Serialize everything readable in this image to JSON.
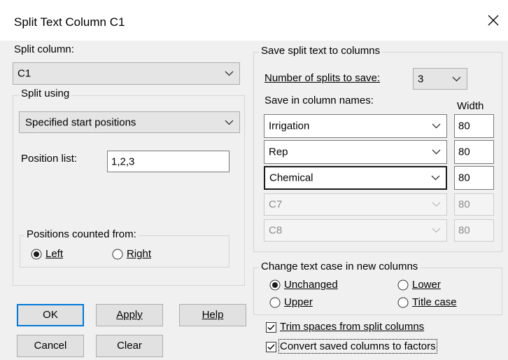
{
  "window": {
    "title": "Split Text Column C1"
  },
  "split_column": {
    "label": "Split column:",
    "value": "C1"
  },
  "split_using": {
    "legend": "Split using",
    "method": "Specified start positions",
    "position_list_label": "Position list:",
    "position_list_value": "1,2,3",
    "positions_from_legend": "Positions counted from:",
    "left_label": "Left",
    "right_label": "Right",
    "selected": "Left"
  },
  "save_split": {
    "legend": "Save split text to columns",
    "num_splits_label": "Number of splits to save:",
    "num_splits_value": "3",
    "names_label": "Save in column names:",
    "width_label": "Width",
    "rows": [
      {
        "name": "Irrigation",
        "width": "80",
        "enabled": true
      },
      {
        "name": "Rep",
        "width": "80",
        "enabled": true
      },
      {
        "name": "Chemical",
        "width": "80",
        "enabled": true
      },
      {
        "name": "C7",
        "width": "80",
        "enabled": false
      },
      {
        "name": "C8",
        "width": "80",
        "enabled": false
      }
    ]
  },
  "text_case": {
    "legend": "Change text case in new columns",
    "unchanged": "Unchanged",
    "lower": "Lower",
    "upper": "Upper",
    "title_case": "Title case",
    "selected": "Unchanged"
  },
  "options": {
    "trim_label": "Trim spaces from split columns",
    "trim_checked": true,
    "factors_label": "Convert saved columns to factors",
    "factors_checked": true
  },
  "buttons": {
    "ok": "OK",
    "apply": "Apply",
    "help": "Help",
    "cancel": "Cancel",
    "clear": "Clear"
  },
  "icons": {
    "close": "close-icon",
    "dropdown": "chevron-down-icon",
    "radio": "radio-icon",
    "check": "checkmark-icon"
  }
}
